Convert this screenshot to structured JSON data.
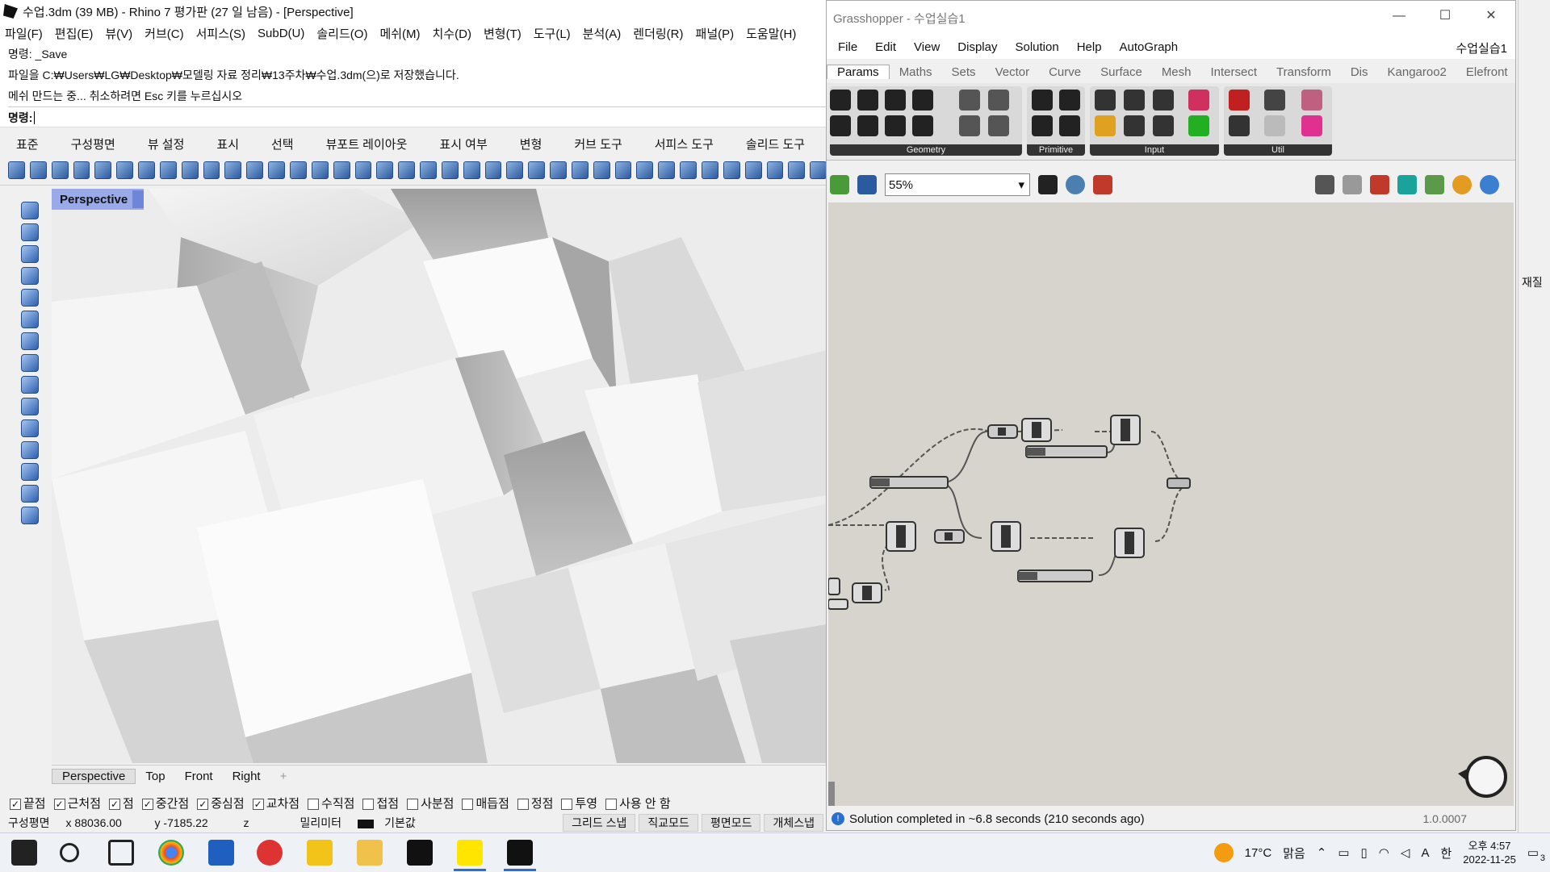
{
  "rhino": {
    "title": "수업.3dm (39 MB) - Rhino 7 평가판 (27 일 남음) - [Perspective]",
    "menu": [
      "파일(F)",
      "편집(E)",
      "뷰(V)",
      "커브(C)",
      "서피스(S)",
      "SubD(U)",
      "솔리드(O)",
      "메쉬(M)",
      "치수(D)",
      "변형(T)",
      "도구(L)",
      "분석(A)",
      "렌더링(R)",
      "패널(P)",
      "도움말(H)"
    ],
    "command_history": [
      "명령: _Save",
      "파일을 C:₩Users₩LG₩Desktop₩모델링 자료 정리₩13주차₩수업.3dm(으)로 저장했습니다.",
      "메쉬 만드는 중... 취소하려면 Esc 키를 누르십시오"
    ],
    "command_prompt": "명령:",
    "toolbar_tabs": [
      "표준",
      "구성평면",
      "뷰 설정",
      "표시",
      "선택",
      "뷰포트 레이아웃",
      "표시 여부",
      "변형",
      "커브 도구",
      "서피스 도구",
      "솔리드 도구"
    ],
    "viewport_label": "Perspective",
    "viewport_tabs": [
      "Perspective",
      "Top",
      "Front",
      "Right"
    ],
    "add_tab_symbol": "+",
    "osnaps": [
      {
        "label": "끝점",
        "checked": true
      },
      {
        "label": "근처점",
        "checked": true
      },
      {
        "label": "점",
        "checked": true
      },
      {
        "label": "중간점",
        "checked": true
      },
      {
        "label": "중심점",
        "checked": true
      },
      {
        "label": "교차점",
        "checked": true
      },
      {
        "label": "수직점",
        "checked": false
      },
      {
        "label": "접점",
        "checked": false
      },
      {
        "label": "사분점",
        "checked": false
      },
      {
        "label": "매듭점",
        "checked": false
      },
      {
        "label": "정점",
        "checked": false
      },
      {
        "label": "투영",
        "checked": false
      },
      {
        "label": "사용 안 함",
        "checked": false
      }
    ],
    "status": {
      "cplane": "구성평면",
      "x": "x 88036.00",
      "y": "y -7185.22",
      "z": "z",
      "units": "밀리미터",
      "layer": "기본값",
      "modes": [
        "그리드 스냅",
        "직교모드",
        "평면모드",
        "개체스냅"
      ]
    }
  },
  "grasshopper": {
    "title": "Grasshopper - 수업실습1",
    "menu": [
      "File",
      "Edit",
      "View",
      "Display",
      "Solution",
      "Help",
      "AutoGraph"
    ],
    "doc_name": "수업실습1",
    "tabs": [
      "Params",
      "Maths",
      "Sets",
      "Vector",
      "Curve",
      "Surface",
      "Mesh",
      "Intersect",
      "Transform",
      "Dis",
      "Kangaroo2",
      "Elefront"
    ],
    "ribbon_groups": [
      "Geometry",
      "Primitive",
      "Input",
      "Util"
    ],
    "zoom": "55%",
    "status_text": "Solution completed in ~6.8 seconds (210 seconds ago)",
    "version": "1.0.0007"
  },
  "right_strip": {
    "label": "재질"
  },
  "taskbar": {
    "weather_temp": "17°C",
    "weather_text": "맑음",
    "ime": "한",
    "time": "오후 4:57",
    "date": "2022-11-25",
    "notification_count": "3",
    "font_indicator": "A"
  },
  "colors": {
    "viewport_label_bg": "#9aaae8",
    "gh_canvas": "#d7d4cd",
    "accent_blue": "#2a6fcf"
  }
}
